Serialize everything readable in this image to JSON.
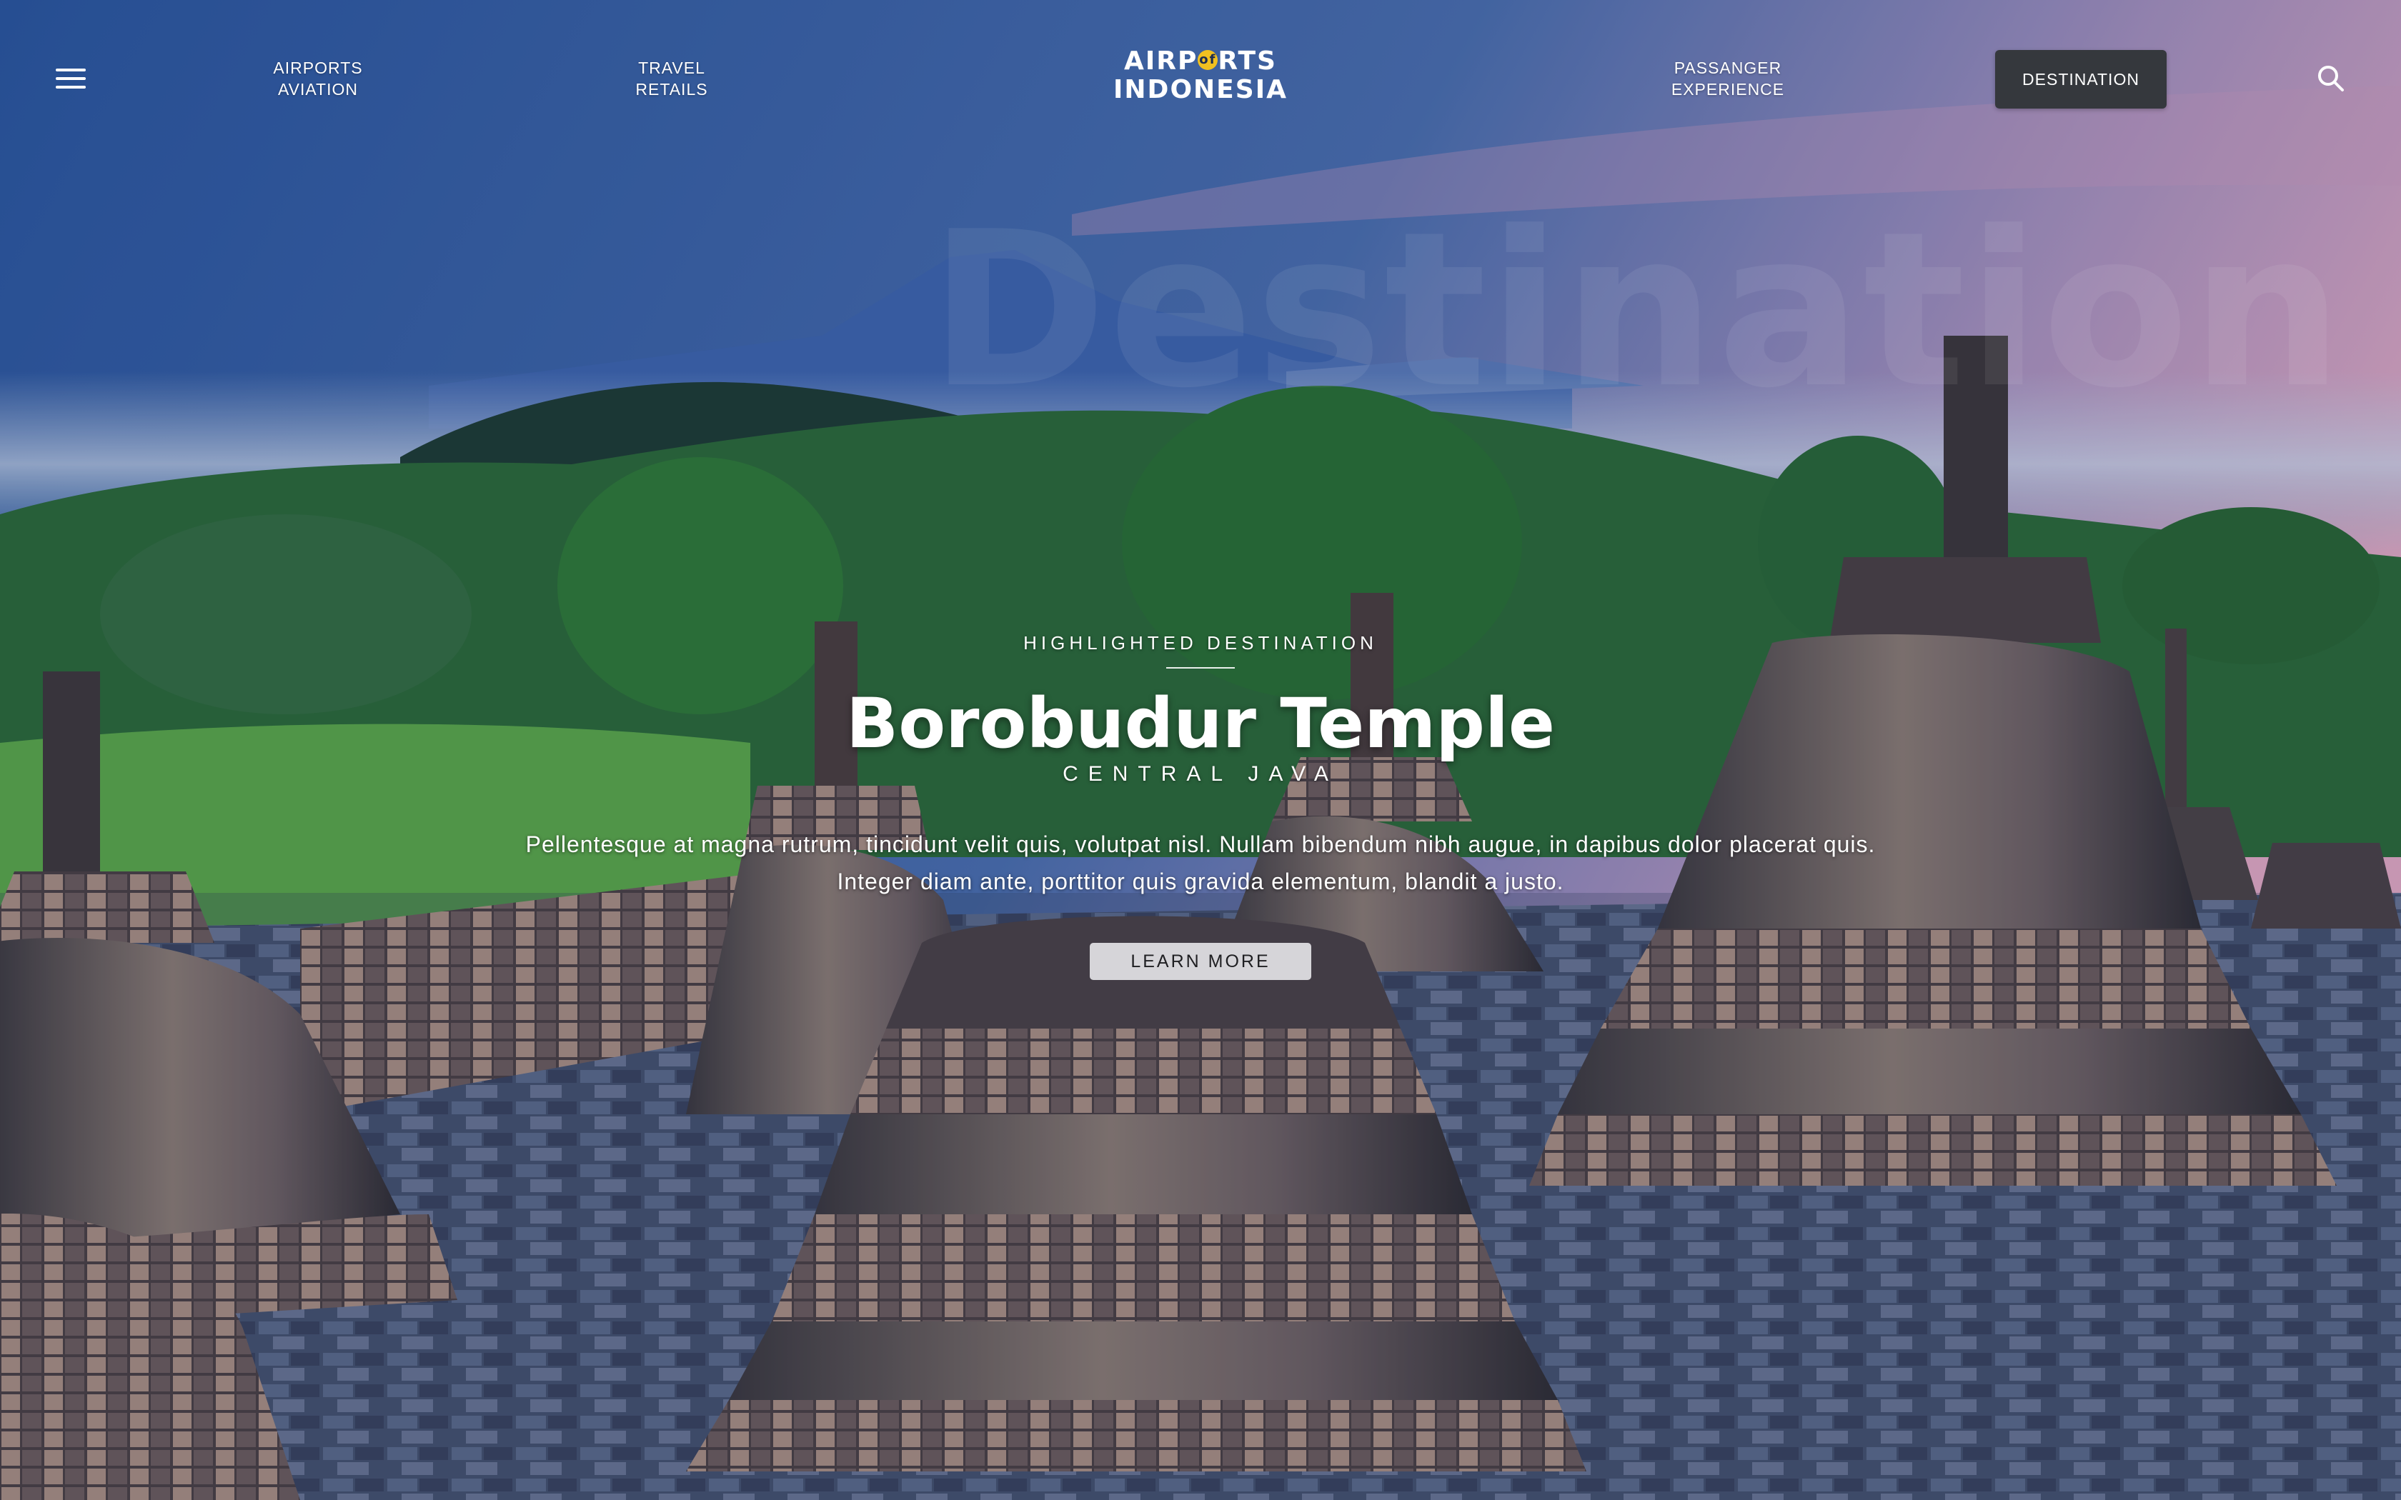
{
  "header": {
    "menu_icon": "hamburger-menu-icon",
    "nav_left": [
      {
        "line1": "AIRPORTS",
        "line2": "AVIATION"
      },
      {
        "line1": "TRAVEL",
        "line2": "RETAILS"
      }
    ],
    "logo": {
      "line1_pre": "AIRP",
      "line1_mark": "of",
      "line1_post": "RTS",
      "line2": "INDONESIA"
    },
    "nav_right": [
      {
        "line1": "PASSANGER",
        "line2": "EXPERIENCE"
      }
    ],
    "destination_button": "DESTINATION",
    "search_icon": "search-icon"
  },
  "background": {
    "ghost_text": "Destination",
    "colors": {
      "sky_top": "#2f5ea3",
      "sky_pink": "#d9a6c6",
      "foliage": "#2f6b3a",
      "grass": "#5aa84c",
      "stone": "#5b5a62"
    }
  },
  "hero": {
    "eyebrow": "HIGHLIGHTED DESTINATION",
    "title": "Borobudur Temple",
    "subtitle": "CENTRAL JAVA",
    "description": "Pellentesque at magna rutrum, tincidunt velit quis, volutpat nisl. Nullam bibendum nibh augue, in dapibus dolor placerat quis. Integer diam ante, porttitor quis gravida elementum, blandit a justo.",
    "cta": "LEARN MORE"
  }
}
